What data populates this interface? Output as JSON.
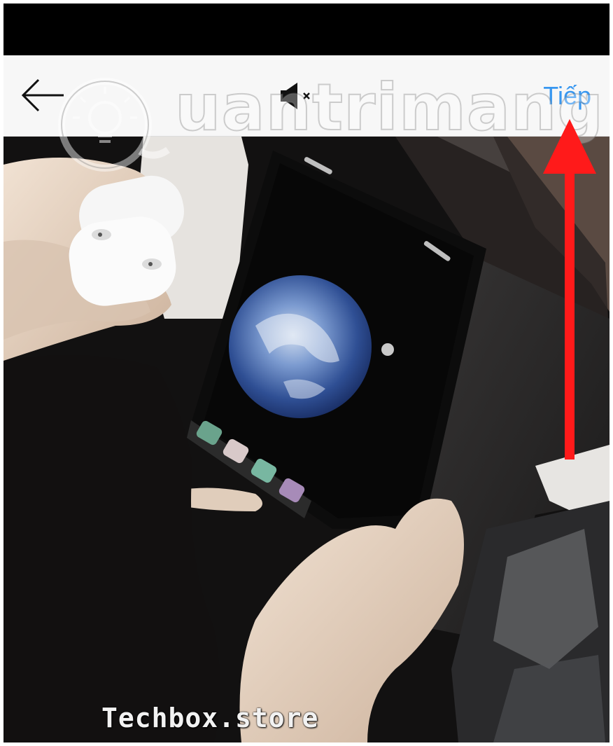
{
  "nav": {
    "back_icon": "arrow-left-icon",
    "mute_icon": "speaker-muted-icon",
    "next_label": "Tiếp"
  },
  "media": {
    "caption": "Techbox.store"
  },
  "watermark": {
    "text": "uantrimang"
  },
  "colors": {
    "accent": "#3897f0",
    "annotation": "#ff1a1a",
    "status_bar": "#000000",
    "nav_bg": "#f7f7f7"
  }
}
